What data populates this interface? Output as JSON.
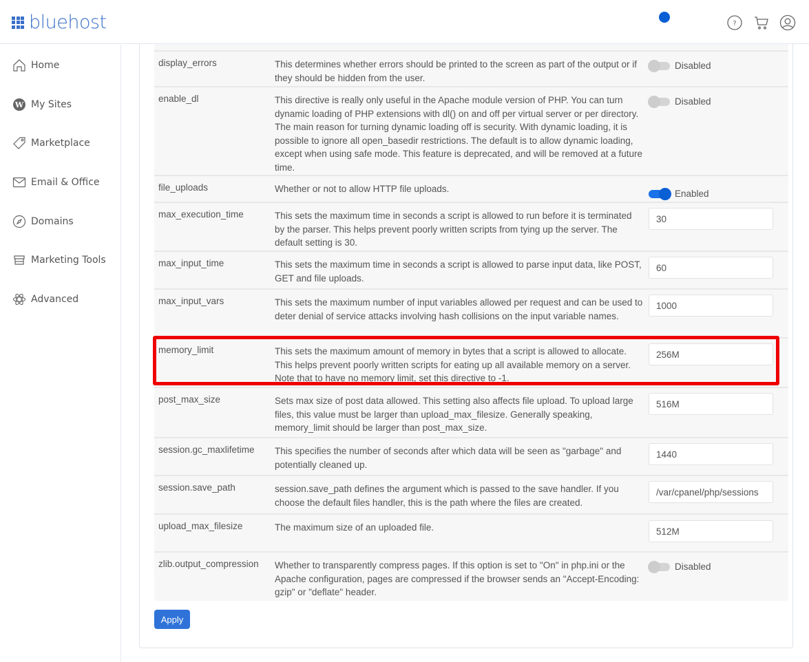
{
  "header": {
    "brand": "bluehost",
    "icons": [
      "help-icon",
      "cart-icon",
      "account-icon"
    ],
    "status_dot_color": "#0a5fd4"
  },
  "sidebar": {
    "items": [
      {
        "label": "Home",
        "icon": "home-icon"
      },
      {
        "label": "My Sites",
        "icon": "wordpress-icon"
      },
      {
        "label": "Marketplace",
        "icon": "tag-icon"
      },
      {
        "label": "Email & Office",
        "icon": "mail-icon"
      },
      {
        "label": "Domains",
        "icon": "compass-icon"
      },
      {
        "label": "Marketing Tools",
        "icon": "store-icon"
      },
      {
        "label": "Advanced",
        "icon": "atom-icon"
      }
    ]
  },
  "settings": [
    {
      "name": "display_errors",
      "description": "This determines whether errors should be printed to the screen as part of the output or if they should be hidden from the user.",
      "type": "toggle",
      "enabled": false,
      "state_label": "Disabled"
    },
    {
      "name": "enable_dl",
      "description": "This directive is really only useful in the Apache module version of PHP. You can turn dynamic loading of PHP extensions with dl() on and off per virtual server or per directory. The main reason for turning dynamic loading off is security. With dynamic loading, it is possible to ignore all open_basedir restrictions. The default is to allow dynamic loading, except when using safe mode. This feature is deprecated, and will be removed at a future time.",
      "type": "toggle",
      "enabled": false,
      "state_label": "Disabled"
    },
    {
      "name": "file_uploads",
      "description": "Whether or not to allow HTTP file uploads.",
      "type": "toggle",
      "enabled": true,
      "state_label": "Enabled"
    },
    {
      "name": "max_execution_time",
      "description": "This sets the maximum time in seconds a script is allowed to run before it is terminated by the parser. This helps prevent poorly written scripts from tying up the server. The default setting is 30.",
      "type": "input",
      "value": "30"
    },
    {
      "name": "max_input_time",
      "description": "This sets the maximum time in seconds a script is allowed to parse input data, like POST, GET and file uploads.",
      "type": "input",
      "value": "60"
    },
    {
      "name": "max_input_vars",
      "description": "This sets the maximum number of input variables allowed per request and can be used to deter denial of service attacks involving hash collisions on the input variable names.",
      "type": "input",
      "value": "1000"
    },
    {
      "name": "memory_limit",
      "description": "This sets the maximum amount of memory in bytes that a script is allowed to allocate. This helps prevent poorly written scripts for eating up all available memory on a server. Note that to have no memory limit, set this directive to -1.",
      "type": "input",
      "value": "256M",
      "highlighted": true
    },
    {
      "name": "post_max_size",
      "description": "Sets max size of post data allowed. This setting also affects file upload. To upload large files, this value must be larger than upload_max_filesize. Generally speaking, memory_limit should be larger than post_max_size.",
      "type": "input",
      "value": "516M"
    },
    {
      "name": "session.gc_maxlifetime",
      "description": "This specifies the number of seconds after which data will be seen as \"garbage\" and potentially cleaned up.",
      "type": "input",
      "value": "1440"
    },
    {
      "name": "session.save_path",
      "description": "session.save_path defines the argument which is passed to the save handler. If you choose the default files handler, this is the path where the files are created.",
      "type": "input",
      "value": "/var/cpanel/php/sessions"
    },
    {
      "name": "upload_max_filesize",
      "description": "The maximum size of an uploaded file.",
      "type": "input",
      "value": "512M"
    },
    {
      "name": "zlib.output_compression",
      "description": "Whether to transparently compress pages. If this option is set to \"On\" in php.ini or the Apache configuration, pages are compressed if the browser sends an \"Accept-Encoding: gzip\" or \"deflate\" header.",
      "type": "toggle",
      "enabled": false,
      "state_label": "Disabled"
    }
  ],
  "actions": {
    "apply_label": "Apply"
  },
  "colors": {
    "brand": "#3a6fc8",
    "accent": "#2f73d9",
    "highlight": "#ee0000"
  }
}
